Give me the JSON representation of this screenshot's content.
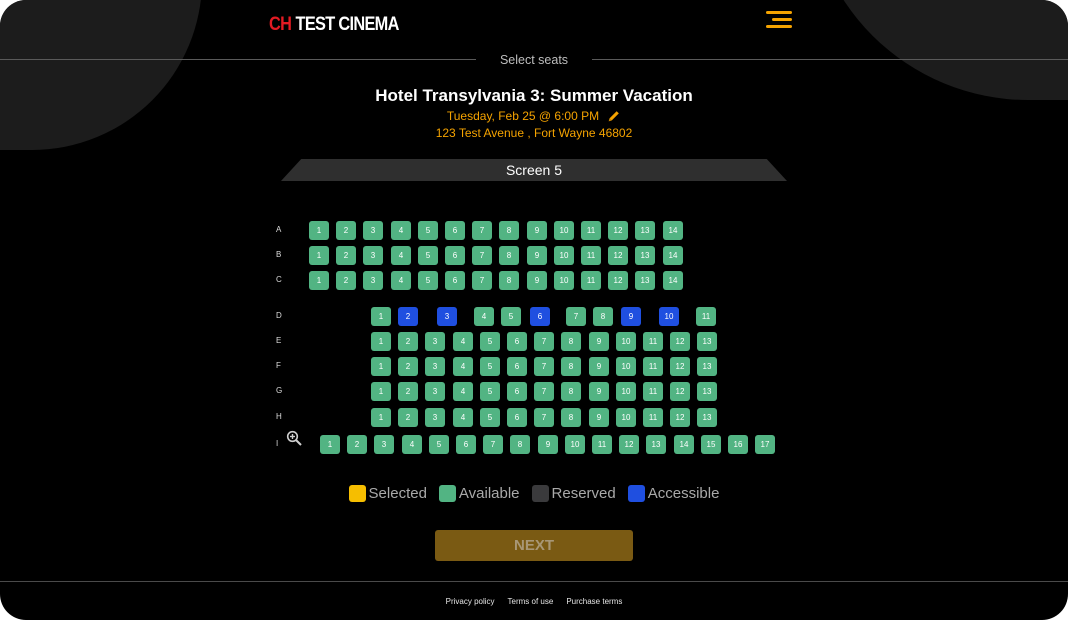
{
  "header": {
    "logo_mark": "CH",
    "logo_name": "TEST CINEMA",
    "section_label": "Select seats"
  },
  "movie": {
    "title": "Hotel Transylvania 3: Summer Vacation",
    "showtime": "Tuesday, Feb 25 @ 6:00 PM",
    "address": "123 Test Avenue , Fort Wayne 46802"
  },
  "screen": {
    "label": "Screen 5"
  },
  "colors": {
    "selected": "#f6be00",
    "available": "#52b483",
    "reserved": "#3a3a3c",
    "accessible": "#1f4fe0",
    "accent": "#f5a300"
  },
  "seat_map": {
    "rows": [
      {
        "label": "A",
        "seats": [
          {
            "n": "1",
            "s": "available"
          },
          {
            "n": "2",
            "s": "available"
          },
          {
            "n": "3",
            "s": "available"
          },
          {
            "n": "4",
            "s": "available"
          },
          {
            "n": "5",
            "s": "available"
          },
          {
            "n": "6",
            "s": "available"
          },
          {
            "n": "7",
            "s": "available"
          },
          {
            "n": "8",
            "s": "available"
          },
          {
            "n": "9",
            "s": "available"
          },
          {
            "n": "10",
            "s": "available"
          },
          {
            "n": "11",
            "s": "available"
          },
          {
            "n": "12",
            "s": "available"
          },
          {
            "n": "13",
            "s": "available"
          },
          {
            "n": "14",
            "s": "available"
          }
        ]
      },
      {
        "label": "B",
        "seats": [
          {
            "n": "1",
            "s": "available"
          },
          {
            "n": "2",
            "s": "available"
          },
          {
            "n": "3",
            "s": "available"
          },
          {
            "n": "4",
            "s": "available"
          },
          {
            "n": "5",
            "s": "available"
          },
          {
            "n": "6",
            "s": "available"
          },
          {
            "n": "7",
            "s": "available"
          },
          {
            "n": "8",
            "s": "available"
          },
          {
            "n": "9",
            "s": "available"
          },
          {
            "n": "10",
            "s": "available"
          },
          {
            "n": "11",
            "s": "available"
          },
          {
            "n": "12",
            "s": "available"
          },
          {
            "n": "13",
            "s": "available"
          },
          {
            "n": "14",
            "s": "available"
          }
        ]
      },
      {
        "label": "C",
        "seats": [
          {
            "n": "1",
            "s": "available"
          },
          {
            "n": "2",
            "s": "available"
          },
          {
            "n": "3",
            "s": "available"
          },
          {
            "n": "4",
            "s": "available"
          },
          {
            "n": "5",
            "s": "available"
          },
          {
            "n": "6",
            "s": "available"
          },
          {
            "n": "7",
            "s": "available"
          },
          {
            "n": "8",
            "s": "available"
          },
          {
            "n": "9",
            "s": "available"
          },
          {
            "n": "10",
            "s": "available"
          },
          {
            "n": "11",
            "s": "available"
          },
          {
            "n": "12",
            "s": "available"
          },
          {
            "n": "13",
            "s": "available"
          },
          {
            "n": "14",
            "s": "available"
          }
        ]
      },
      {
        "label": "D",
        "seats": [
          {
            "n": "1",
            "s": "available"
          },
          {
            "n": "2",
            "s": "accessible"
          },
          {
            "n": "3",
            "s": "accessible"
          },
          {
            "n": "4",
            "s": "available"
          },
          {
            "n": "5",
            "s": "available"
          },
          {
            "n": "6",
            "s": "accessible"
          },
          {
            "n": "7",
            "s": "available"
          },
          {
            "n": "8",
            "s": "available"
          },
          {
            "n": "9",
            "s": "accessible"
          },
          {
            "n": "10",
            "s": "accessible"
          },
          {
            "n": "11",
            "s": "available"
          }
        ]
      },
      {
        "label": "E",
        "seats": [
          {
            "n": "1",
            "s": "available"
          },
          {
            "n": "2",
            "s": "available"
          },
          {
            "n": "3",
            "s": "available"
          },
          {
            "n": "4",
            "s": "available"
          },
          {
            "n": "5",
            "s": "available"
          },
          {
            "n": "6",
            "s": "available"
          },
          {
            "n": "7",
            "s": "available"
          },
          {
            "n": "8",
            "s": "available"
          },
          {
            "n": "9",
            "s": "available"
          },
          {
            "n": "10",
            "s": "available"
          },
          {
            "n": "11",
            "s": "available"
          },
          {
            "n": "12",
            "s": "available"
          },
          {
            "n": "13",
            "s": "available"
          }
        ]
      },
      {
        "label": "F",
        "seats": [
          {
            "n": "1",
            "s": "available"
          },
          {
            "n": "2",
            "s": "available"
          },
          {
            "n": "3",
            "s": "available"
          },
          {
            "n": "4",
            "s": "available"
          },
          {
            "n": "5",
            "s": "available"
          },
          {
            "n": "6",
            "s": "available"
          },
          {
            "n": "7",
            "s": "available"
          },
          {
            "n": "8",
            "s": "available"
          },
          {
            "n": "9",
            "s": "available"
          },
          {
            "n": "10",
            "s": "available"
          },
          {
            "n": "11",
            "s": "available"
          },
          {
            "n": "12",
            "s": "available"
          },
          {
            "n": "13",
            "s": "available"
          }
        ]
      },
      {
        "label": "G",
        "seats": [
          {
            "n": "1",
            "s": "available"
          },
          {
            "n": "2",
            "s": "available"
          },
          {
            "n": "3",
            "s": "available"
          },
          {
            "n": "4",
            "s": "available"
          },
          {
            "n": "5",
            "s": "available"
          },
          {
            "n": "6",
            "s": "available"
          },
          {
            "n": "7",
            "s": "available"
          },
          {
            "n": "8",
            "s": "available"
          },
          {
            "n": "9",
            "s": "available"
          },
          {
            "n": "10",
            "s": "available"
          },
          {
            "n": "11",
            "s": "available"
          },
          {
            "n": "12",
            "s": "available"
          },
          {
            "n": "13",
            "s": "available"
          }
        ]
      },
      {
        "label": "H",
        "seats": [
          {
            "n": "1",
            "s": "available"
          },
          {
            "n": "2",
            "s": "available"
          },
          {
            "n": "3",
            "s": "available"
          },
          {
            "n": "4",
            "s": "available"
          },
          {
            "n": "5",
            "s": "available"
          },
          {
            "n": "6",
            "s": "available"
          },
          {
            "n": "7",
            "s": "available"
          },
          {
            "n": "8",
            "s": "available"
          },
          {
            "n": "9",
            "s": "available"
          },
          {
            "n": "10",
            "s": "available"
          },
          {
            "n": "11",
            "s": "available"
          },
          {
            "n": "12",
            "s": "available"
          },
          {
            "n": "13",
            "s": "available"
          }
        ]
      },
      {
        "label": "I",
        "seats": [
          {
            "n": "1",
            "s": "available"
          },
          {
            "n": "2",
            "s": "available"
          },
          {
            "n": "3",
            "s": "available"
          },
          {
            "n": "4",
            "s": "available"
          },
          {
            "n": "5",
            "s": "available"
          },
          {
            "n": "6",
            "s": "available"
          },
          {
            "n": "7",
            "s": "available"
          },
          {
            "n": "8",
            "s": "available"
          },
          {
            "n": "9",
            "s": "available"
          },
          {
            "n": "10",
            "s": "available"
          },
          {
            "n": "11",
            "s": "available"
          },
          {
            "n": "12",
            "s": "available"
          },
          {
            "n": "13",
            "s": "available"
          },
          {
            "n": "14",
            "s": "available"
          },
          {
            "n": "15",
            "s": "available"
          },
          {
            "n": "16",
            "s": "available"
          },
          {
            "n": "17",
            "s": "available"
          }
        ]
      }
    ]
  },
  "legend": {
    "selected": "Selected",
    "available": "Available",
    "reserved": "Reserved",
    "accessible": "Accessible"
  },
  "actions": {
    "next_label": "NEXT"
  },
  "footer": {
    "privacy": "Privacy policy",
    "terms": "Terms of use",
    "purchase": "Purchase terms"
  },
  "icons": {
    "menu": "hamburger-menu-icon",
    "edit": "pencil-icon",
    "zoom": "zoom-in-icon"
  }
}
